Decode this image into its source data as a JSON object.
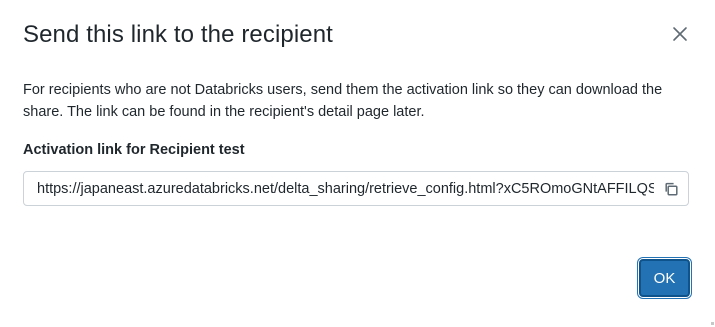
{
  "dialog": {
    "title": "Send this link to the recipient",
    "description": "For recipients who are not Databricks users, send them the activation link so they can download the share. The link can be found in the recipient's detail page later.",
    "field_label": "Activation link for Recipient test",
    "link_value": "https://japaneast.azuredatabricks.net/delta_sharing/retrieve_config.html?xC5ROmoGNtAFFILQS",
    "ok_label": "OK"
  },
  "icons": {
    "close": "close-icon",
    "copy": "copy-icon"
  },
  "colors": {
    "primary": "#2272b4",
    "text": "#1f272d",
    "border": "#cbd2d8",
    "icon": "#5f6b74"
  }
}
